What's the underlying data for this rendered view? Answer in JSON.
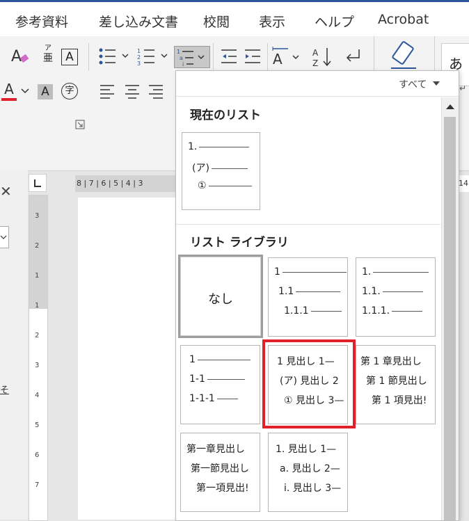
{
  "ribbon_tabs": [
    "参考資料",
    "差し込み文書",
    "校閲",
    "表示",
    "ヘルプ",
    "Acrobat"
  ],
  "colors": {
    "tab_accent": "#2b579a",
    "highlight_box": "#e0202a",
    "font_color_bar": "#e0202a"
  },
  "ribbon": {
    "font_color_glyph": "A",
    "phonetic_top": "ア",
    "phonetic_bottom": "亜",
    "bordered_char": "A",
    "enclosed_char": "字",
    "shaded_char": "A",
    "japanese_glyph": "あ",
    "icons": [
      "clear-format-icon",
      "phonetic-guide-icon",
      "char-border-icon",
      "bullets-icon",
      "numbering-icon",
      "multilevel-list-icon",
      "decrease-indent-icon",
      "increase-indent-icon",
      "text-direction-icon",
      "sort-icon",
      "paragraph-mark-icon",
      "align-left-icon",
      "align-center-icon",
      "align-right-icon",
      "acrobat-icon",
      "dialog-launcher-icon"
    ]
  },
  "ruler": {
    "horizontal": "8 | 7 | 6 | 5 | 4 | 3",
    "right_number": "14",
    "vertical": [
      "3",
      "2",
      "1",
      "1",
      "2",
      "3",
      "4",
      "5",
      "6",
      "7"
    ]
  },
  "left_pane": {
    "close": "✕",
    "link_char": "そ"
  },
  "dropdown": {
    "filter_label": "すべて",
    "current_list_title": "現在のリスト",
    "current_list": [
      "1.",
      "(ア)",
      "①"
    ],
    "library_title": "リスト ライブラリ",
    "none_label": "なし",
    "tiles": [
      {
        "lines": [
          "1",
          "1.1",
          "1.1.1"
        ]
      },
      {
        "lines": [
          "1.",
          "1.1.",
          "1.1.1."
        ]
      },
      {
        "lines": [
          "1",
          "1-1",
          "1-1-1"
        ]
      },
      {
        "lines": [
          "1 見出し 1—",
          "(ア) 見出し 2",
          "① 見出し 3—"
        ],
        "highlighted": true
      },
      {
        "lines": [
          "第 1 章見出し",
          "第 1 節見出し",
          "第 1 項見出!"
        ]
      },
      {
        "lines": [
          "第一章見出し",
          "第一節見出し",
          "第一項見出!"
        ]
      },
      {
        "lines": [
          "1. 見出し 1—",
          "a. 見出し 2—",
          "i. 見出し 3—"
        ]
      }
    ]
  }
}
